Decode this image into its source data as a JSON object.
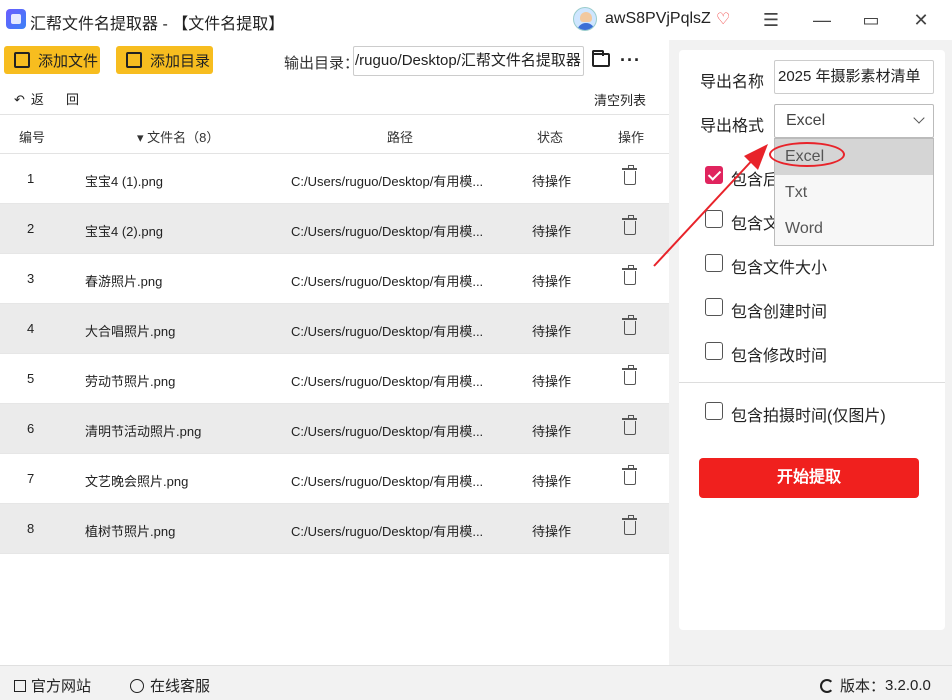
{
  "window": {
    "title": "汇帮文件名提取器 - 【文件名提取】",
    "user_name": "awS8PVjPqlsZ"
  },
  "toolbar": {
    "add_file_label": "添加文件",
    "add_dir_label": "添加目录",
    "output_dir_label": "输出目录：",
    "output_dir_value": "/ruguo/Desktop/汇帮文件名提取器",
    "back_label": "返",
    "back_label2": "回",
    "clear_list_label": "清空列表"
  },
  "table": {
    "headers": {
      "index": "编号",
      "filename": "▾ 文件名（8）",
      "path": "路径",
      "status": "状态",
      "action": "操作"
    },
    "rows": [
      {
        "index": "1",
        "name": "宝宝4 (1).png",
        "path": "C:/Users/ruguo/Desktop/有用模...",
        "status": "待操作"
      },
      {
        "index": "2",
        "name": "宝宝4 (2).png",
        "path": "C:/Users/ruguo/Desktop/有用模...",
        "status": "待操作"
      },
      {
        "index": "3",
        "name": "春游照片.png",
        "path": "C:/Users/ruguo/Desktop/有用模...",
        "status": "待操作"
      },
      {
        "index": "4",
        "name": "大合唱照片.png",
        "path": "C:/Users/ruguo/Desktop/有用模...",
        "status": "待操作"
      },
      {
        "index": "5",
        "name": "劳动节照片.png",
        "path": "C:/Users/ruguo/Desktop/有用模...",
        "status": "待操作"
      },
      {
        "index": "6",
        "name": "清明节活动照片.png",
        "path": "C:/Users/ruguo/Desktop/有用模...",
        "status": "待操作"
      },
      {
        "index": "7",
        "name": "文艺晚会照片.png",
        "path": "C:/Users/ruguo/Desktop/有用模...",
        "status": "待操作"
      },
      {
        "index": "8",
        "name": "植树节照片.png",
        "path": "C:/Users/ruguo/Desktop/有用模...",
        "status": "待操作"
      }
    ]
  },
  "export": {
    "name_label": "导出名称",
    "name_value": "2025 年摄影素材清单",
    "format_label": "导出格式",
    "format_value": "Excel",
    "format_options": [
      "Excel",
      "Txt",
      "Word"
    ],
    "options": [
      {
        "label": "包含后",
        "checked": true
      },
      {
        "label": "包含文",
        "checked": false
      },
      {
        "label": "包含文件大小",
        "checked": false
      },
      {
        "label": "包含创建时间",
        "checked": false
      },
      {
        "label": "包含修改时间",
        "checked": false
      },
      {
        "label": "包含拍摄时间(仅图片)",
        "checked": false
      }
    ],
    "start_label": "开始提取"
  },
  "footer": {
    "website_label": "官方网站",
    "service_label": "在线客服",
    "version_label": "版本：",
    "version_value": "3.2.0.0"
  },
  "colors": {
    "accent_yellow": "#f7bd1f",
    "start_red": "#f0201e",
    "check_pink": "#e0245e",
    "annotation_red": "#e8232a"
  }
}
